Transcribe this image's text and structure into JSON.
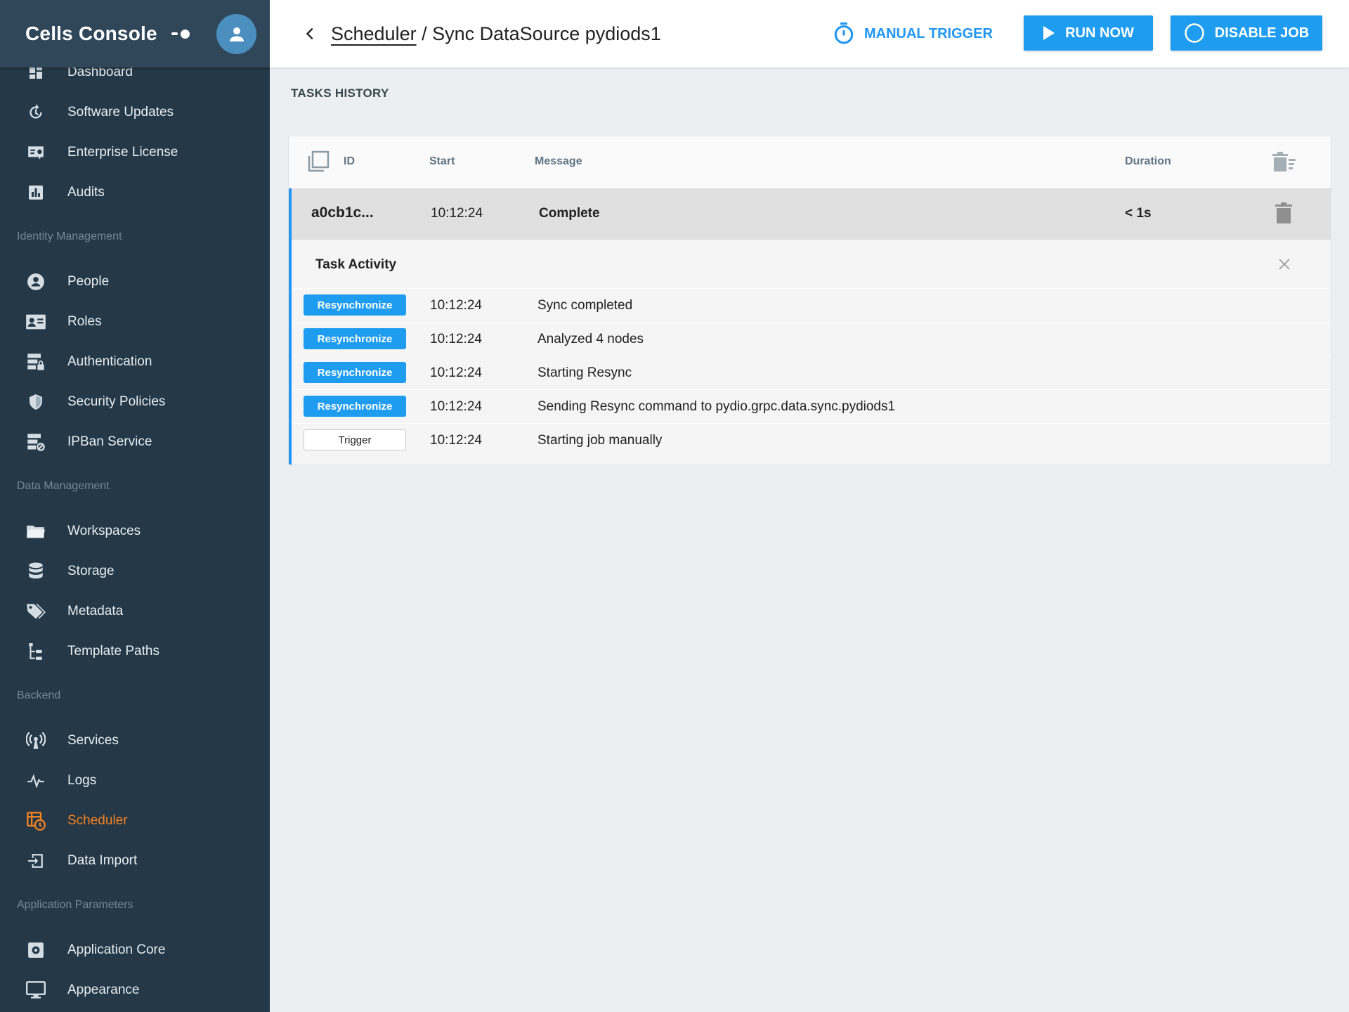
{
  "app": {
    "title": "Cells Console"
  },
  "sidebar": {
    "items": [
      {
        "label": "Dashboard",
        "icon": "dashboard-icon"
      },
      {
        "label": "Software Updates",
        "icon": "update-icon"
      },
      {
        "label": "Enterprise License",
        "icon": "license-icon"
      },
      {
        "label": "Audits",
        "icon": "chart-icon"
      }
    ],
    "identity": {
      "title": "Identity Management",
      "items": [
        {
          "label": "People",
          "icon": "person-icon"
        },
        {
          "label": "Roles",
          "icon": "id-card-icon"
        },
        {
          "label": "Authentication",
          "icon": "server-lock-icon"
        },
        {
          "label": "Security Policies",
          "icon": "shield-icon"
        },
        {
          "label": "IPBan Service",
          "icon": "server-ban-icon"
        }
      ]
    },
    "data": {
      "title": "Data Management",
      "items": [
        {
          "label": "Workspaces",
          "icon": "folder-icon"
        },
        {
          "label": "Storage",
          "icon": "database-icon"
        },
        {
          "label": "Metadata",
          "icon": "tags-icon"
        },
        {
          "label": "Template Paths",
          "icon": "file-tree-icon"
        }
      ]
    },
    "backend": {
      "title": "Backend",
      "items": [
        {
          "label": "Services",
          "icon": "broadcast-icon"
        },
        {
          "label": "Logs",
          "icon": "pulse-icon"
        },
        {
          "label": "Scheduler",
          "icon": "calendar-clock-icon"
        },
        {
          "label": "Data Import",
          "icon": "import-icon"
        }
      ]
    },
    "params": {
      "title": "Application Parameters",
      "items": [
        {
          "label": "Application Core",
          "icon": "settings-box-icon"
        },
        {
          "label": "Appearance",
          "icon": "monitor-icon"
        }
      ]
    },
    "active_color": "#f48120"
  },
  "header": {
    "breadcrumb_link": "Scheduler",
    "breadcrumb_separator": " / ",
    "breadcrumb_current": "Sync DataSource pydiods1",
    "manual_trigger": "MANUAL TRIGGER",
    "run_now": "RUN NOW",
    "disable_job": "DISABLE JOB",
    "accent": "#2196f3"
  },
  "tasks": {
    "section_title": "TASKS HISTORY",
    "columns": {
      "id": "ID",
      "start": "Start",
      "message": "Message",
      "duration": "Duration"
    },
    "row": {
      "id": "a0cb1c...",
      "start": "10:12:24",
      "message": "Complete",
      "duration": "< 1s"
    },
    "activity": {
      "title": "Task Activity",
      "rows": [
        {
          "tag": "Resynchronize",
          "time": "10:12:24",
          "message": "Sync completed"
        },
        {
          "tag": "Resynchronize",
          "time": "10:12:24",
          "message": "Analyzed 4 nodes"
        },
        {
          "tag": "Resynchronize",
          "time": "10:12:24",
          "message": "Starting Resync"
        },
        {
          "tag": "Resynchronize",
          "time": "10:12:24",
          "message": "Sending Resync command to pydio.grpc.data.sync.pydiods1"
        },
        {
          "tag": "Trigger",
          "time": "10:12:24",
          "message": "Starting job manually"
        }
      ]
    }
  }
}
